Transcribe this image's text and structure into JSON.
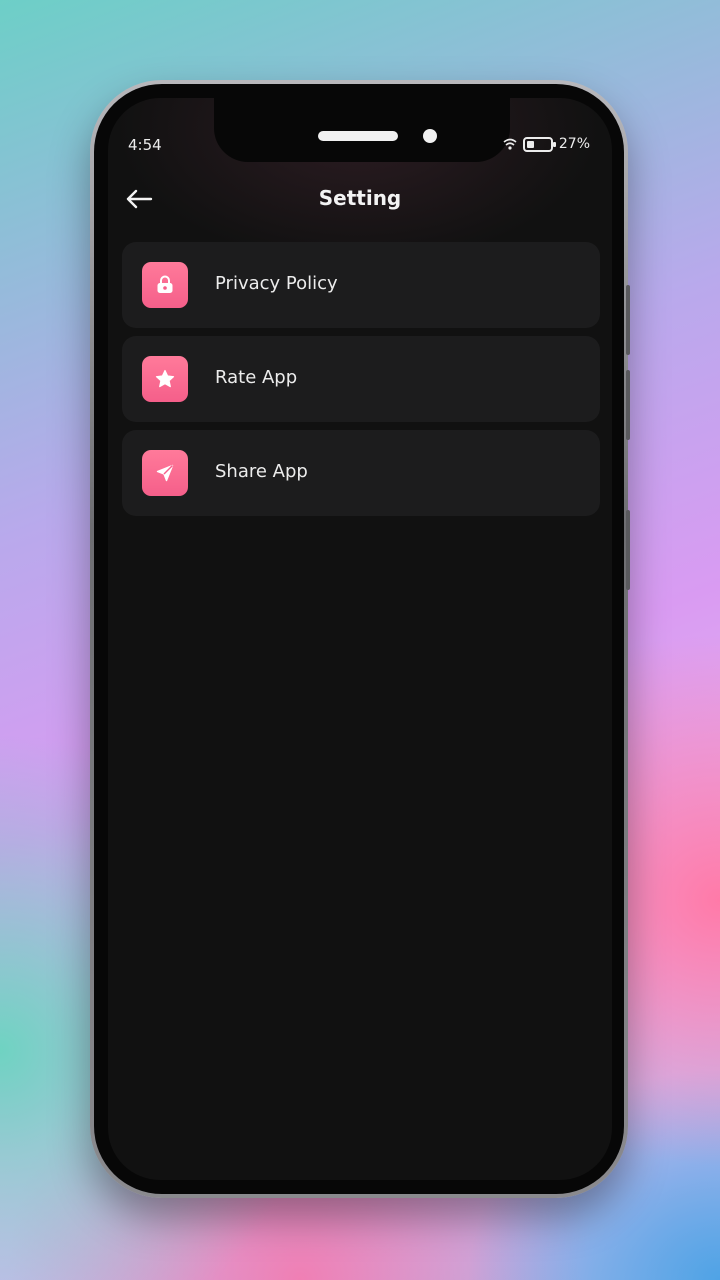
{
  "status_bar": {
    "time": "4:54",
    "battery_percent": "27%",
    "battery_level": 0.27
  },
  "header": {
    "title": "Setting",
    "back_icon": "arrow-left-icon"
  },
  "settings": [
    {
      "label": "Privacy Policy",
      "icon": "lock-icon"
    },
    {
      "label": "Rate App",
      "icon": "star-icon"
    },
    {
      "label": "Share App",
      "icon": "send-icon"
    }
  ],
  "colors": {
    "accent": "#f55f8a",
    "row_bg": "#1c1c1d",
    "screen_bg": "#111111"
  }
}
